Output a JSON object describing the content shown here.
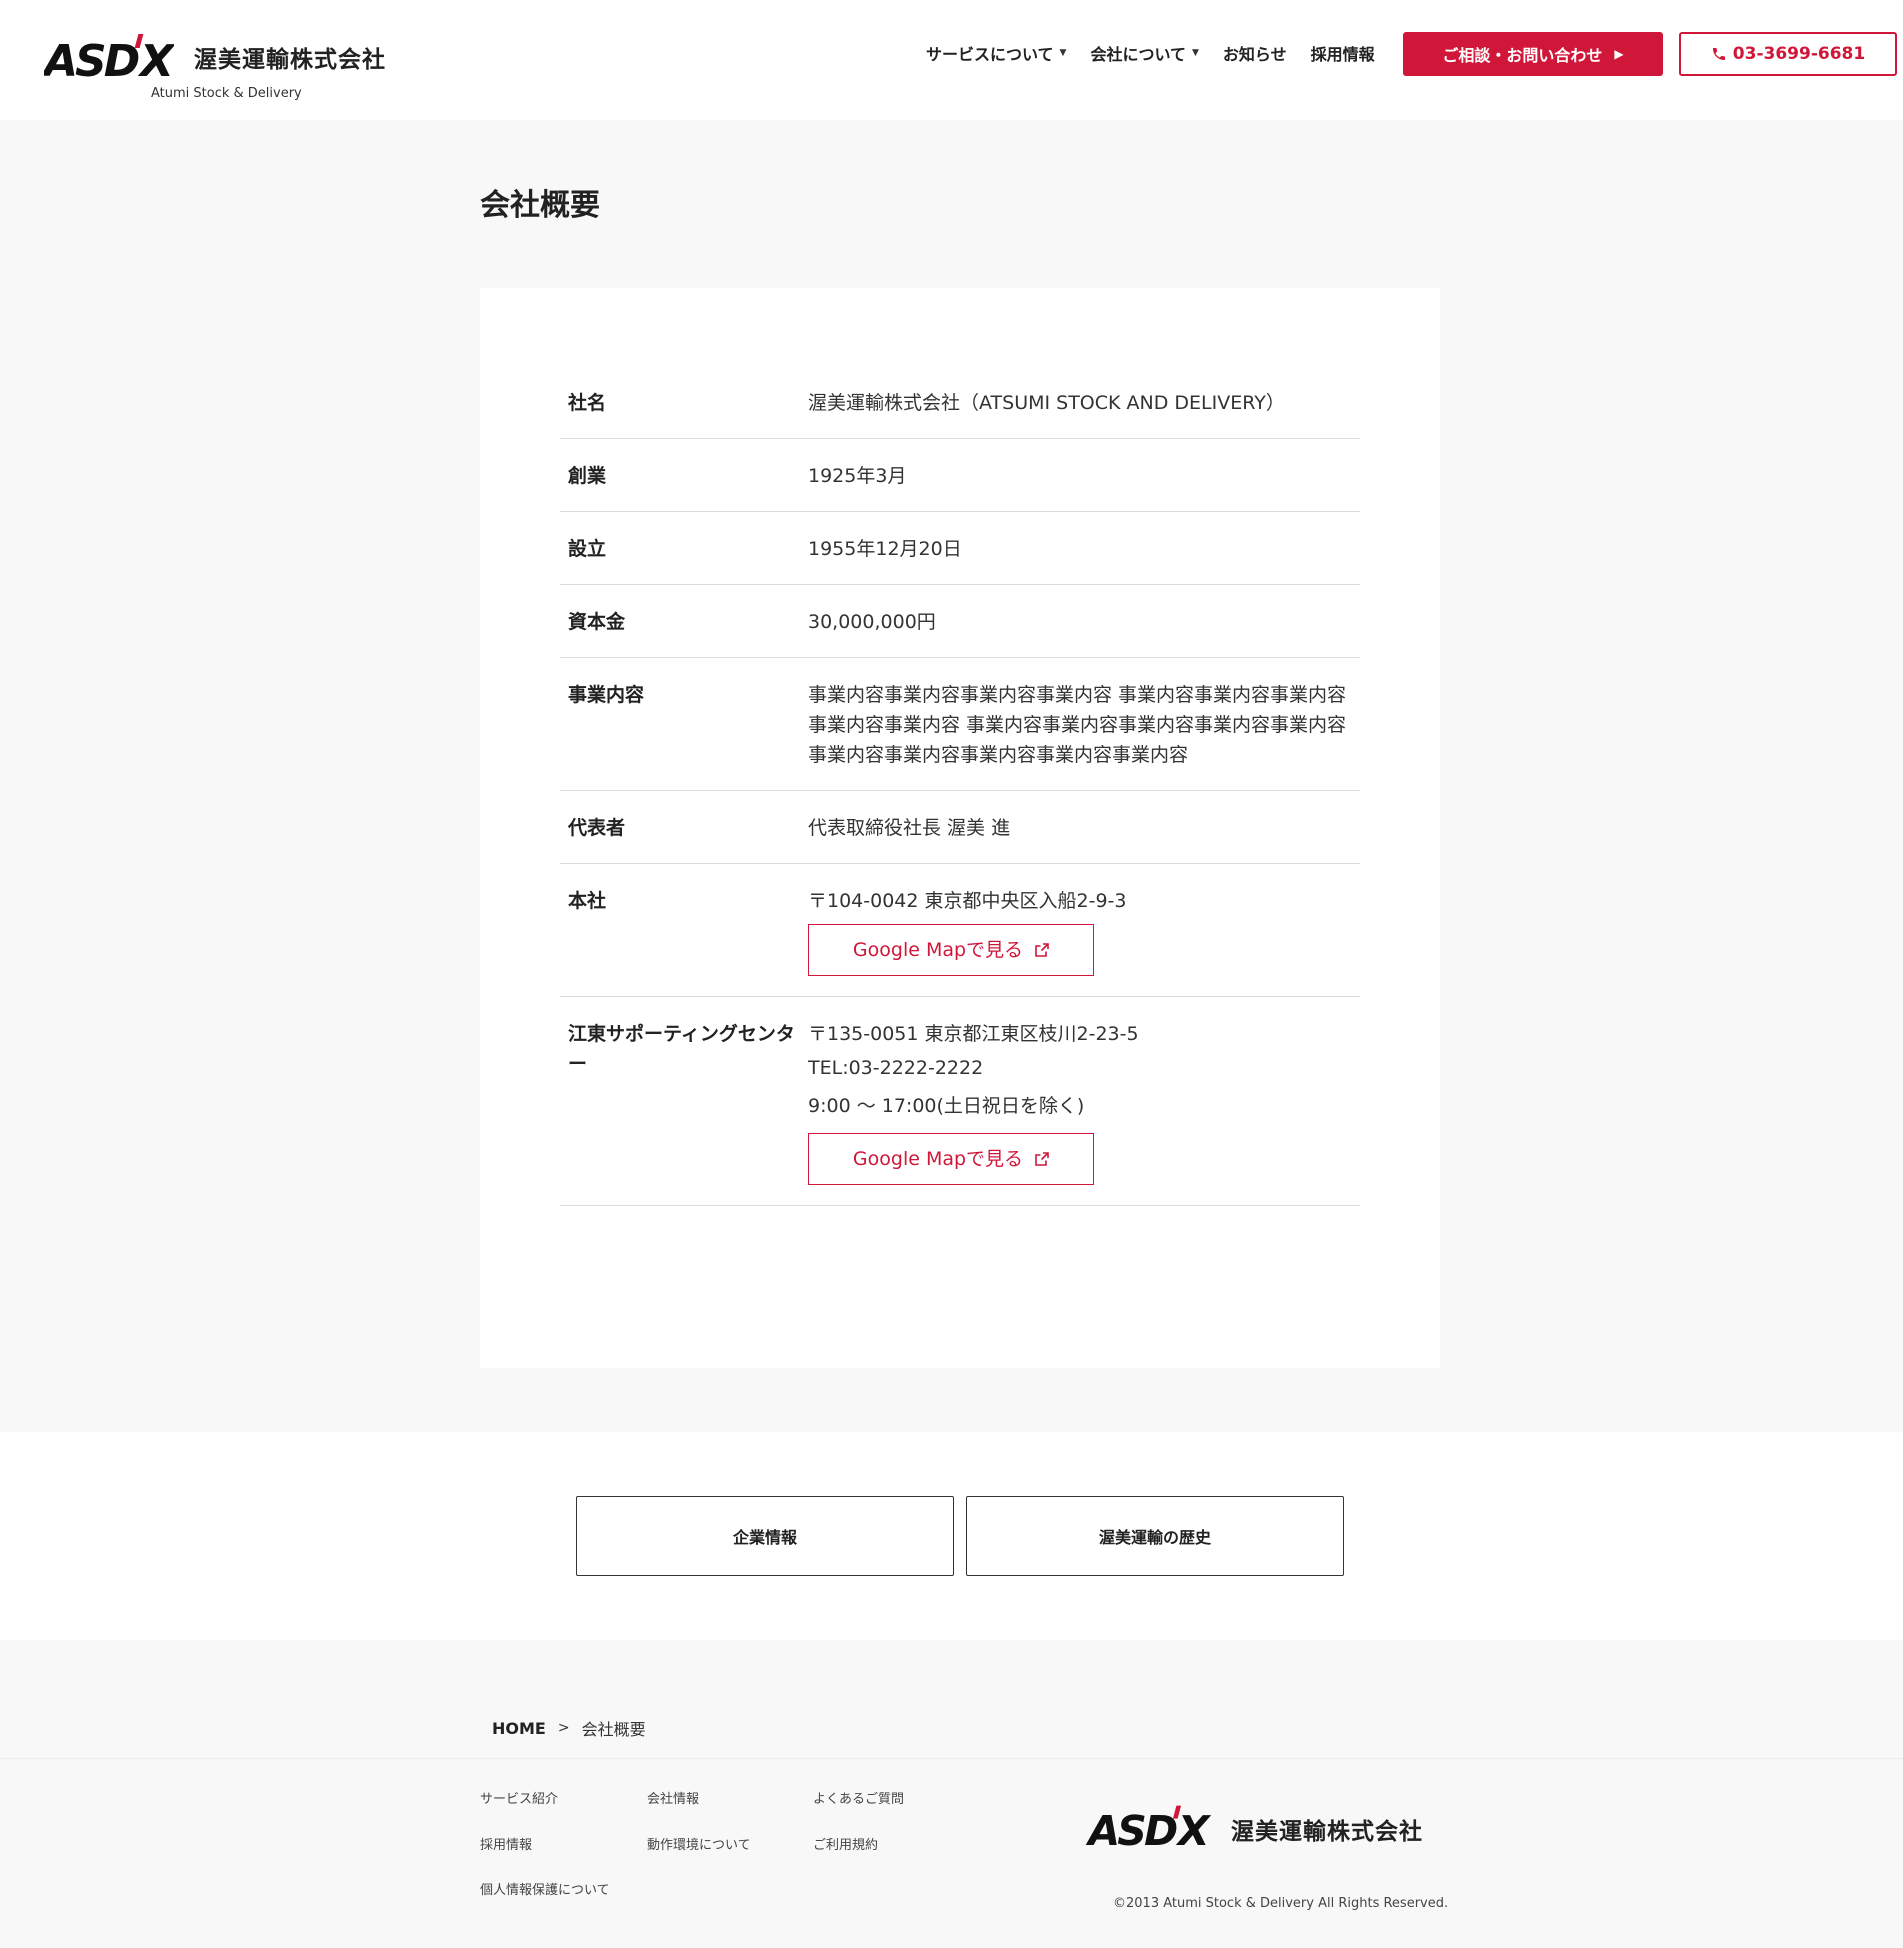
{
  "header": {
    "logo_name": "渥美運輸株式会社",
    "logo_sub": "Atumi Stock & Delivery",
    "nav": [
      {
        "label": "サービスについて",
        "dropdown": true
      },
      {
        "label": "会社について",
        "dropdown": true
      },
      {
        "label": "お知らせ",
        "dropdown": false
      },
      {
        "label": "採用情報",
        "dropdown": false
      }
    ],
    "contact_label": "ご相談・お問い合わせ",
    "tel_label": "03-3699-6681",
    "accent": "#d0173a"
  },
  "page": {
    "title": "会社概要"
  },
  "company": {
    "rows": [
      {
        "label": "社名",
        "value": "渥美運輸株式会社（ATSUMI STOCK AND DELIVERY）"
      },
      {
        "label": "創業",
        "value": "1925年3月"
      },
      {
        "label": "設立",
        "value": "1955年12月20日"
      },
      {
        "label": "資本金",
        "value": "30,000,000円"
      },
      {
        "label": "事業内容",
        "value": "事業内容事業内容事業内容事業内容 事業内容事業内容事業内容事業内容事業内容 事業内容事業内容事業内容事業内容事業内容事業内容事業内容事業内容事業内容事業内容"
      },
      {
        "label": "代表者",
        "value": "代表取締役社長 渥美 進"
      },
      {
        "label": "本社",
        "address": "〒104-0042 東京都中央区入船2-9-3",
        "map_label": "Google Mapで見る"
      },
      {
        "label": "江東サポーティングセンター",
        "address": "〒135-0051 東京都江東区枝川2-23-5",
        "tel": "TEL:03-2222-2222",
        "hours": "9:00 ～ 17:00(土日祝日を除く)",
        "map_label": "Google Mapで見る"
      }
    ]
  },
  "related": {
    "items": [
      "企業情報",
      "渥美運輸の歴史"
    ]
  },
  "breadcrumb": {
    "home": "HOME",
    "current": "会社概要"
  },
  "footer": {
    "links": [
      [
        "サービス紹介",
        "会社情報",
        "よくあるご質問"
      ],
      [
        "採用情報",
        "動作環境について",
        "ご利用規約"
      ],
      [
        "個人情報保護について"
      ]
    ],
    "logo_name": "渥美運輸株式会社",
    "copyright": "©2013 Atumi Stock & Delivery All Rights Reserved."
  }
}
